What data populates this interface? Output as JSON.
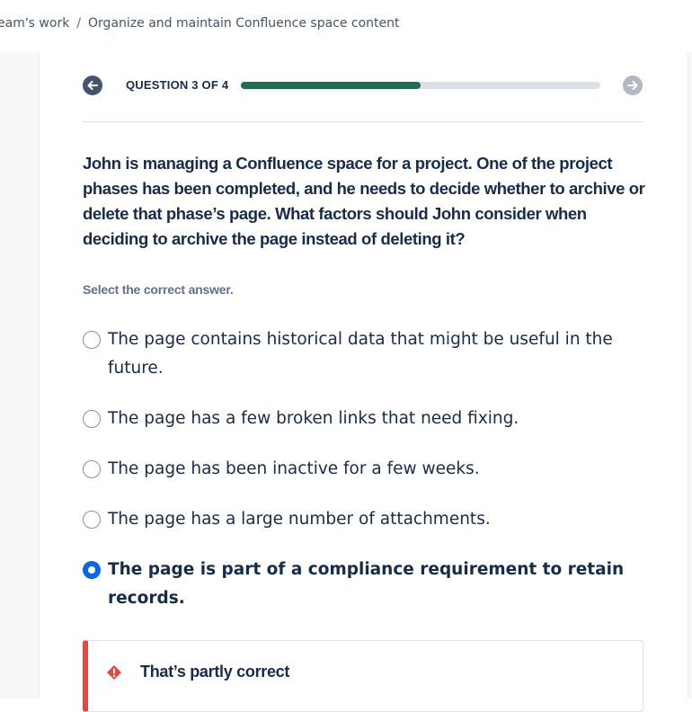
{
  "breadcrumb": {
    "items": [
      "eam's work",
      "Organize and maintain Confluence space content"
    ],
    "separator": "/"
  },
  "progress": {
    "label": "QUESTION 3 OF 4",
    "current": 3,
    "total": 4,
    "fill_fraction": 0.5,
    "color": "#216e4e"
  },
  "question": {
    "text": "John is managing a Confluence space for a project. One of the project phases has been completed, and he needs to decide whether to archive or delete that phase’s page. What factors should John consider when deciding to archive the page instead of deleting it?"
  },
  "instruction": "Select the correct answer.",
  "options": [
    {
      "label": "The page contains historical data that might be useful in the future.",
      "selected": false
    },
    {
      "label": "The page has a few broken links that need fixing.",
      "selected": false
    },
    {
      "label": "The page has been inactive for a few weeks.",
      "selected": false
    },
    {
      "label": "The page has a large number of attachments.",
      "selected": false
    },
    {
      "label": "The page is part of a compliance requirement to retain records.",
      "selected": true
    }
  ],
  "feedback": {
    "title": "That’s partly correct",
    "icon": "warning-icon",
    "accent": "#e2483d"
  },
  "icons": {
    "back": "arrow-left-icon",
    "next": "arrow-right-icon"
  }
}
